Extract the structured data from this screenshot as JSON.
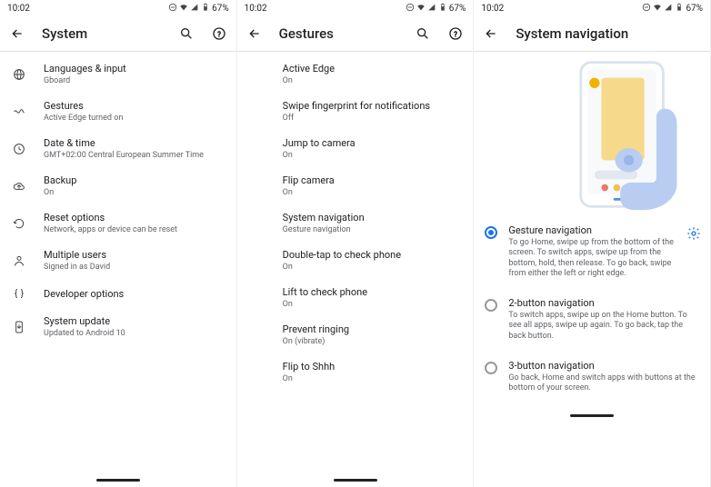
{
  "status": {
    "time": "10:02",
    "battery": "67%"
  },
  "screen1": {
    "title": "System",
    "items": [
      {
        "primary": "Languages & input",
        "secondary": "Gboard"
      },
      {
        "primary": "Gestures",
        "secondary": "Active Edge turned on"
      },
      {
        "primary": "Date & time",
        "secondary": "GMT+02:00 Central European Summer Time"
      },
      {
        "primary": "Backup",
        "secondary": "On"
      },
      {
        "primary": "Reset options",
        "secondary": "Network, apps or device can be reset"
      },
      {
        "primary": "Multiple users",
        "secondary": "Signed in as David"
      },
      {
        "primary": "Developer options",
        "secondary": ""
      },
      {
        "primary": "System update",
        "secondary": "Updated to Android 10"
      }
    ]
  },
  "screen2": {
    "title": "Gestures",
    "items": [
      {
        "primary": "Active Edge",
        "secondary": "On"
      },
      {
        "primary": "Swipe fingerprint for notifications",
        "secondary": "Off"
      },
      {
        "primary": "Jump to camera",
        "secondary": "On"
      },
      {
        "primary": "Flip camera",
        "secondary": "On"
      },
      {
        "primary": "System navigation",
        "secondary": "Gesture navigation"
      },
      {
        "primary": "Double-tap to check phone",
        "secondary": "On"
      },
      {
        "primary": "Lift to check phone",
        "secondary": "On"
      },
      {
        "primary": "Prevent ringing",
        "secondary": "On (vibrate)"
      },
      {
        "primary": "Flip to Shhh",
        "secondary": "On"
      }
    ]
  },
  "screen3": {
    "title": "System navigation",
    "options": [
      {
        "title": "Gesture navigation",
        "desc": "To go Home, swipe up from the bottom of the screen. To switch apps, swipe up from the bottom, hold, then release. To go back, swipe from either the left or right edge.",
        "selected": true,
        "gear": true
      },
      {
        "title": "2-button navigation",
        "desc": "To switch apps, swipe up on the Home button. To see all apps, swipe up again. To go back, tap the back button.",
        "selected": false,
        "gear": false
      },
      {
        "title": "3-button navigation",
        "desc": "Go back, Home and switch apps with buttons at the bottom of your screen.",
        "selected": false,
        "gear": false
      }
    ]
  }
}
